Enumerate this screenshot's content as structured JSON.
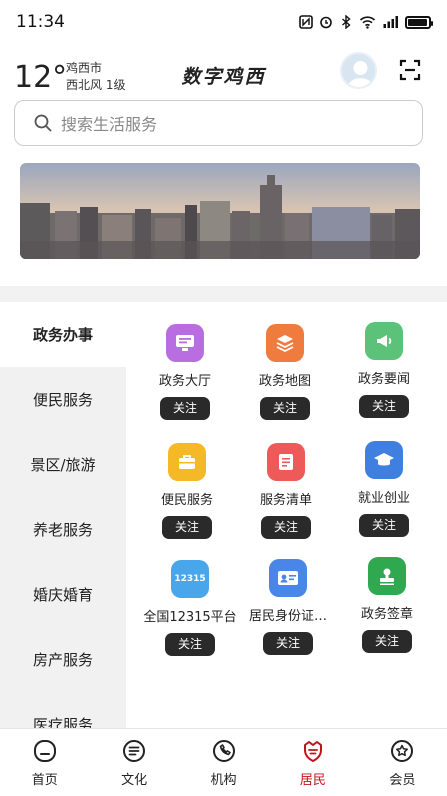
{
  "status_bar": {
    "time": "11:34"
  },
  "weather": {
    "temperature": "12°",
    "city": "鸡西市",
    "wind": "西北风 1级"
  },
  "header": {
    "title": "数字鸡西"
  },
  "search": {
    "placeholder": "搜索生活服务"
  },
  "sidebar": {
    "items": [
      {
        "label": "政务办事"
      },
      {
        "label": "便民服务"
      },
      {
        "label": "景区/旅游"
      },
      {
        "label": "养老服务"
      },
      {
        "label": "婚庆婚育"
      },
      {
        "label": "房产服务"
      },
      {
        "label": "医疗服务"
      }
    ]
  },
  "services": {
    "follow_label": "关注",
    "items": [
      {
        "label": "政务大厅",
        "icon": "monitor-icon",
        "color": "#b86de0"
      },
      {
        "label": "政务地图",
        "icon": "layers-icon",
        "color": "#f07b3f"
      },
      {
        "label": "政务要闻",
        "icon": "megaphone-icon",
        "color": "#5cc27a"
      },
      {
        "label": "便民服务",
        "icon": "briefcase-icon",
        "color": "#f5b928"
      },
      {
        "label": "服务清单",
        "icon": "list-icon",
        "color": "#ee5a5a"
      },
      {
        "label": "就业创业",
        "icon": "graduation-cap-icon",
        "color": "#3f7fe0"
      },
      {
        "label": "全国12315平台",
        "icon": "badge-12315-icon",
        "color": "#4aa6ea",
        "badge": "12315"
      },
      {
        "label": "居民身份证…",
        "icon": "id-card-icon",
        "color": "#4a86e8"
      },
      {
        "label": "政务签章",
        "icon": "stamp-icon",
        "color": "#2fa84f"
      }
    ]
  },
  "tabbar": {
    "accent": "#c0141c",
    "items": [
      {
        "label": "首页",
        "icon": "home-icon"
      },
      {
        "label": "文化",
        "icon": "culture-icon"
      },
      {
        "label": "机构",
        "icon": "institution-icon"
      },
      {
        "label": "居民",
        "icon": "resident-icon",
        "active": true
      },
      {
        "label": "会员",
        "icon": "member-icon"
      }
    ]
  }
}
